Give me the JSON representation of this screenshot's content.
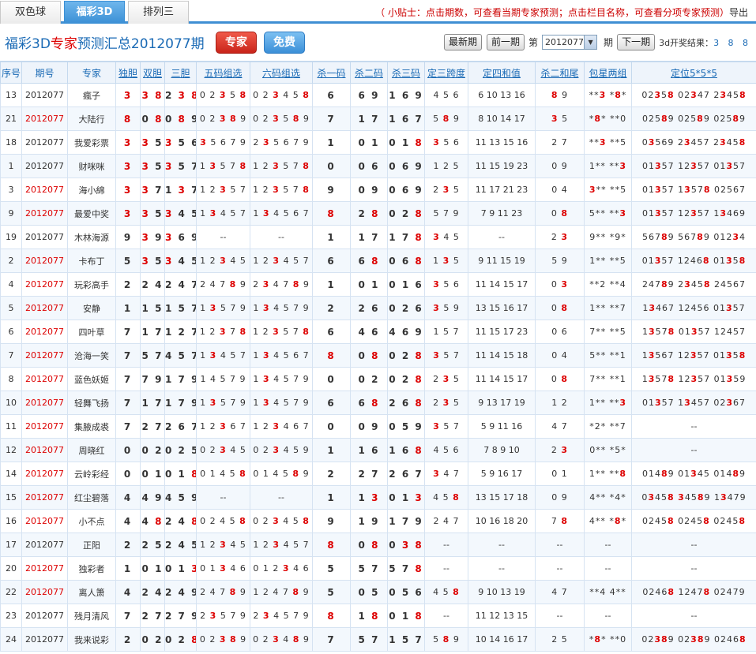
{
  "tabs": [
    "双色球",
    "福彩3D",
    "排列三"
  ],
  "active_tab": 1,
  "tip": "（ 小贴士：点击期数，可查看当期专家预测；点击栏目名称，可查看分项专家预测）",
  "export_label": "导出",
  "title": {
    "prefix": "福彩3D",
    "em": "专家",
    "suffix": "预测汇总2012077期"
  },
  "btn_expert": "专家",
  "btn_free": "免费",
  "nav": {
    "latest": "最新期",
    "prev": "前一期",
    "di": "第",
    "period_value": "2012077",
    "qi": "期",
    "next": "下一期",
    "result_label": "3d开奖结果：",
    "result_nums": "3 8 8"
  },
  "columns": [
    "序号",
    "期号",
    "专家",
    "独胆",
    "双胆",
    "三胆",
    "五码组选",
    "六码组选",
    "杀一码",
    "杀二码",
    "杀三码",
    "定三跨度",
    "定四和值",
    "杀二和尾",
    "包星两组",
    "定位5*5*5"
  ],
  "rows": [
    {
      "no": "13",
      "period": "2012077",
      "red": false,
      "expert": "瘋子",
      "d1": "3",
      "d2": "3 8",
      "d3": "2 3 8",
      "w5": "0 2 3 5 8",
      "w6": "0 2 3 4 5 8",
      "k1": "6",
      "k2": "6 9",
      "k3": "1 6 9",
      "kd": "4 5 6",
      "hz": "6 10 13 16",
      "hw": "8 9",
      "bx": "**3 *8*",
      "dw": "02358 02347 23458"
    },
    {
      "no": "21",
      "period": "2012077",
      "red": true,
      "expert": "大陆行",
      "d1": "8",
      "d2": "0 8",
      "d3": "0 8 9",
      "w5": "0 2 3 8 9",
      "w6": "0 2 3 5 8 9",
      "k1": "7",
      "k2": "1 7",
      "k3": "1 6 7",
      "kd": "5 8 9",
      "hz": "8 10 14 17",
      "hw": "3 5",
      "bx": "*8* **0",
      "dw": "02589 02589 02589"
    },
    {
      "no": "18",
      "period": "2012077",
      "red": false,
      "expert": "我爱彩票",
      "d1": "3",
      "d2": "3 5",
      "d3": "3 5 6",
      "w5": "3 5 6 7 9",
      "w6": "2 3 5 6 7 9",
      "k1": "1",
      "k2": "0 1",
      "k3": "0 1 8",
      "kd": "3 5 6",
      "hz": "11 13 15 16",
      "hw": "2 7",
      "bx": "**3 **5",
      "dw": "03569 23457 23458"
    },
    {
      "no": "1",
      "period": "2012077",
      "red": false,
      "expert": "财咪咪",
      "d1": "3",
      "d2": "3 5",
      "d3": "3 5 7",
      "w5": "1 3 5 7 8",
      "w6": "1 2 3 5 7 8",
      "k1": "0",
      "k2": "0 6",
      "k3": "0 6 9",
      "kd": "1 2 5",
      "hz": "11 15 19 23",
      "hw": "0 9",
      "bx": "1** **3",
      "dw": "01357 12357 01357"
    },
    {
      "no": "3",
      "period": "2012077",
      "red": true,
      "expert": "海小綿",
      "d1": "3",
      "d2": "3 7",
      "d3": "1 3 7",
      "w5": "1 2 3 5 7",
      "w6": "1 2 3 5 7 8",
      "k1": "9",
      "k2": "0 9",
      "k3": "0 6 9",
      "kd": "2 3 5",
      "hz": "11 17 21 23",
      "hw": "0 4",
      "bx": "3** **5",
      "dw": "01357 13578 02567"
    },
    {
      "no": "9",
      "period": "2012077",
      "red": true,
      "expert": "最爱中奖",
      "d1": "3",
      "d2": "3 5",
      "d3": "3 4 5",
      "w5": "1 3 4 5 7",
      "w6": "1 3 4 5 6 7",
      "k1": "8",
      "k2": "2 8",
      "k3": "0 2 8",
      "kd": "5 7 9",
      "hz": "7 9 11 23",
      "hw": "0 8",
      "bx": "5** **3",
      "dw": "01357 12357 13469"
    },
    {
      "no": "19",
      "period": "2012077",
      "red": false,
      "expert": "木林海源",
      "d1": "9",
      "d2": "3 9",
      "d3": "3 6 9",
      "w5": "--",
      "w6": "--",
      "k1": "1",
      "k2": "1 7",
      "k3": "1 7 8",
      "kd": "3 4 5",
      "hz": "--",
      "hw": "2 3",
      "bx": "9** *9*",
      "dw": "56789 56789 01234"
    },
    {
      "no": "2",
      "period": "2012077",
      "red": true,
      "expert": "卡布丁",
      "d1": "5",
      "d2": "3 5",
      "d3": "3 4 5",
      "w5": "1 2 3 4 5",
      "w6": "1 2 3 4 5 7",
      "k1": "6",
      "k2": "6 8",
      "k3": "0 6 8",
      "kd": "1 3 5",
      "hz": "9 11 15 19",
      "hw": "5 9",
      "bx": "1** **5",
      "dw": "01357 12468 01358"
    },
    {
      "no": "4",
      "period": "2012077",
      "red": true,
      "expert": "玩彩高手",
      "d1": "2",
      "d2": "2 4",
      "d3": "2 4 7",
      "w5": "2 4 7 8 9",
      "w6": "2 3 4 7 8 9",
      "k1": "1",
      "k2": "0 1",
      "k3": "0 1 6",
      "kd": "3 5 6",
      "hz": "11 14 15 17",
      "hw": "0 3",
      "bx": "**2 **4",
      "dw": "24789 23458 24567"
    },
    {
      "no": "5",
      "period": "2012077",
      "red": true,
      "expert": "安静",
      "d1": "1",
      "d2": "1 5",
      "d3": "1 5 7",
      "w5": "1 3 5 7 9",
      "w6": "1 3 4 5 7 9",
      "k1": "2",
      "k2": "2 6",
      "k3": "0 2 6",
      "kd": "3 5 9",
      "hz": "13 15 16 17",
      "hw": "0 8",
      "bx": "1** **7",
      "dw": "13467 12456 01357"
    },
    {
      "no": "6",
      "period": "2012077",
      "red": true,
      "expert": "四叶草",
      "d1": "7",
      "d2": "1 7",
      "d3": "1 2 7",
      "w5": "1 2 3 7 8",
      "w6": "1 2 3 5 7 8",
      "k1": "6",
      "k2": "4 6",
      "k3": "4 6 9",
      "kd": "1 5 7",
      "hz": "11 15 17 23",
      "hw": "0 6",
      "bx": "7** **5",
      "dw": "13578 01357 12457"
    },
    {
      "no": "7",
      "period": "2012077",
      "red": true,
      "expert": "沧海一笑",
      "d1": "7",
      "d2": "5 7",
      "d3": "4 5 7",
      "w5": "1 3 4 5 7",
      "w6": "1 3 4 5 6 7",
      "k1": "8",
      "k2": "0 8",
      "k3": "0 2 8",
      "kd": "3 5 7",
      "hz": "11 14 15 18",
      "hw": "0 4",
      "bx": "5** **1",
      "dw": "13567 12357 01358"
    },
    {
      "no": "8",
      "period": "2012077",
      "red": true,
      "expert": "蓝色妖姬",
      "d1": "7",
      "d2": "7 9",
      "d3": "1 7 9",
      "w5": "1 4 5 7 9",
      "w6": "1 3 4 5 7 9",
      "k1": "0",
      "k2": "0 2",
      "k3": "0 2 8",
      "kd": "2 3 5",
      "hz": "11 14 15 17",
      "hw": "0 8",
      "bx": "7** **1",
      "dw": "13578 12357 01359"
    },
    {
      "no": "10",
      "period": "2012077",
      "red": true,
      "expert": "轻舞飞扬",
      "d1": "7",
      "d2": "1 7",
      "d3": "1 7 9",
      "w5": "1 3 5 7 9",
      "w6": "1 3 4 5 7 9",
      "k1": "6",
      "k2": "6 8",
      "k3": "2 6 8",
      "kd": "2 3 5",
      "hz": "9 13 17 19",
      "hw": "1 2",
      "bx": "1** **3",
      "dw": "01357 13457 02367"
    },
    {
      "no": "11",
      "period": "2012077",
      "red": true,
      "expert": "集腋成裘",
      "d1": "7",
      "d2": "2 7",
      "d3": "2 6 7",
      "w5": "1 2 3 6 7",
      "w6": "1 2 3 4 6 7",
      "k1": "0",
      "k2": "0 9",
      "k3": "0 5 9",
      "kd": "3 5 7",
      "hz": "5 9 11 16",
      "hw": "4 7",
      "bx": "*2* **7",
      "dw": "--"
    },
    {
      "no": "12",
      "period": "2012077",
      "red": true,
      "expert": "周晓红",
      "d1": "0",
      "d2": "0 2",
      "d3": "0 2 5",
      "w5": "0 2 3 4 5",
      "w6": "0 2 3 4 5 9",
      "k1": "1",
      "k2": "1 6",
      "k3": "1 6 8",
      "kd": "4 5 6",
      "hz": "7 8 9 10",
      "hw": "2 3",
      "bx": "0** *5*",
      "dw": "--"
    },
    {
      "no": "14",
      "period": "2012077",
      "red": true,
      "expert": "云岭彩经",
      "d1": "0",
      "d2": "0 1",
      "d3": "0 1 8",
      "w5": "0 1 4 5 8",
      "w6": "0 1 4 5 8 9",
      "k1": "2",
      "k2": "2 7",
      "k3": "2 6 7",
      "kd": "3 4 7",
      "hz": "5 9 16 17",
      "hw": "0 1",
      "bx": "1** **8",
      "dw": "01489 01345 01489"
    },
    {
      "no": "15",
      "period": "2012077",
      "red": true,
      "expert": "红尘碧落",
      "d1": "4",
      "d2": "4 9",
      "d3": "4 5 9",
      "w5": "--",
      "w6": "--",
      "k1": "1",
      "k2": "1 3",
      "k3": "0 1 3",
      "kd": "4 5 8",
      "hz": "13 15 17 18",
      "hw": "0 9",
      "bx": "4** *4*",
      "dw": "03458 34589 13479"
    },
    {
      "no": "16",
      "period": "2012077",
      "red": true,
      "expert": "小不点",
      "d1": "4",
      "d2": "4 8",
      "d3": "2 4 8",
      "w5": "0 2 4 5 8",
      "w6": "0 2 3 4 5 8",
      "k1": "9",
      "k2": "1 9",
      "k3": "1 7 9",
      "kd": "2 4 7",
      "hz": "10 16 18 20",
      "hw": "7 8",
      "bx": "4** *8*",
      "dw": "02458 02458 02458"
    },
    {
      "no": "17",
      "period": "2012077",
      "red": false,
      "expert": "正阳",
      "d1": "2",
      "d2": "2 5",
      "d3": "2 4 5",
      "w5": "1 2 3 4 5",
      "w6": "1 2 3 4 5 7",
      "k1": "8",
      "k2": "0 8",
      "k3": "0 3 8",
      "kd": "--",
      "hz": "--",
      "hw": "--",
      "bx": "--",
      "dw": "--"
    },
    {
      "no": "20",
      "period": "2012077",
      "red": true,
      "expert": "独彩者",
      "d1": "1",
      "d2": "0 1",
      "d3": "0 1 3",
      "w5": "0 1 3 4 6",
      "w6": "0 1 2 3 4 6",
      "k1": "5",
      "k2": "5 7",
      "k3": "5 7 8",
      "kd": "--",
      "hz": "--",
      "hw": "--",
      "bx": "--",
      "dw": "--"
    },
    {
      "no": "22",
      "period": "2012077",
      "red": true,
      "expert": "离人箫",
      "d1": "4",
      "d2": "2 4",
      "d3": "2 4 9",
      "w5": "2 4 7 8 9",
      "w6": "1 2 4 7 8 9",
      "k1": "5",
      "k2": "0 5",
      "k3": "0 5 6",
      "kd": "4 5 8",
      "hz": "9 10 13 19",
      "hw": "4 7",
      "bx": "**4 4**",
      "dw": "02468 12478 02479"
    },
    {
      "no": "23",
      "period": "2012077",
      "red": false,
      "expert": "残月清风",
      "d1": "7",
      "d2": "2 7",
      "d3": "2 7 9",
      "w5": "2 3 5 7 9",
      "w6": "2 3 4 5 7 9",
      "k1": "8",
      "k2": "1 8",
      "k3": "0 1 8",
      "kd": "--",
      "hz": "11 12 13 15",
      "hw": "--",
      "bx": "--",
      "dw": "--"
    },
    {
      "no": "24",
      "period": "2012077",
      "red": false,
      "expert": "我来说彩",
      "d1": "2",
      "d2": "0 2",
      "d3": "0 2 8",
      "w5": "0 2 3 8 9",
      "w6": "0 2 3 4 8 9",
      "k1": "7",
      "k2": "5 7",
      "k3": "1 5 7",
      "kd": "5 8 9",
      "hz": "10 14 16 17",
      "hw": "2 5",
      "bx": "*8* **0",
      "dw": "02389 02389 02468"
    }
  ]
}
